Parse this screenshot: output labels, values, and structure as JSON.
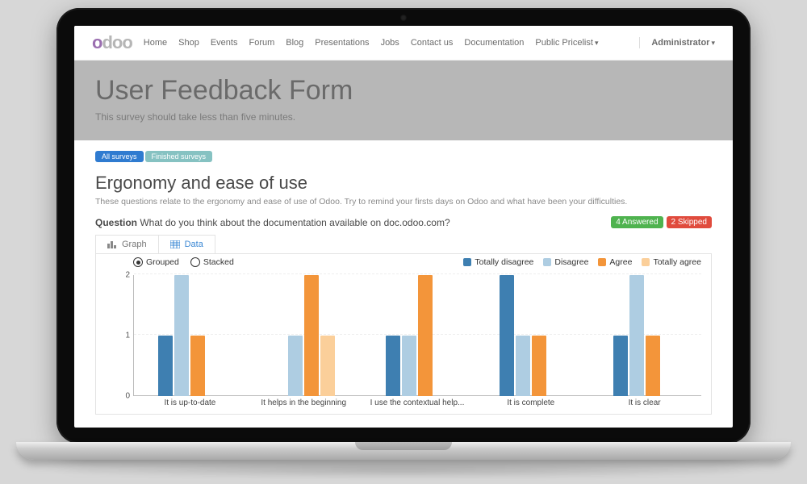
{
  "brand": {
    "text": "odoo"
  },
  "nav": {
    "items": [
      "Home",
      "Shop",
      "Events",
      "Forum",
      "Blog",
      "Presentations",
      "Jobs",
      "Contact us",
      "Documentation",
      "Public Pricelist"
    ],
    "user": "Administrator"
  },
  "hero": {
    "title": "User Feedback Form",
    "subtitle": "This survey should take less than five minutes."
  },
  "pills": {
    "all": "All surveys",
    "finished": "Finished surveys"
  },
  "section": {
    "title": "Ergonomy and ease of use",
    "desc": "These questions relate to the ergonomy and ease of use of Odoo. Try to remind your firsts days on Odoo and what have been your difficulties."
  },
  "question": {
    "label": "Question",
    "text": "What do you think about the documentation available on doc.odoo.com?",
    "answered_label": "4 Answered",
    "skipped_label": "2 Skipped"
  },
  "tabs": {
    "graph": "Graph",
    "data": "Data"
  },
  "toggles": {
    "grouped": "Grouped",
    "stacked": "Stacked"
  },
  "legend": {
    "td": "Totally disagree",
    "d": "Disagree",
    "a": "Agree",
    "ta": "Totally agree"
  },
  "chart_data": {
    "type": "bar",
    "grouping": "grouped",
    "ylabel": "",
    "xlabel": "",
    "ylim": [
      0,
      2
    ],
    "yticks": [
      0,
      1,
      2
    ],
    "categories": [
      "It is up-to-date",
      "It helps in the beginning",
      "I use the contextual help...",
      "It is complete",
      "It is clear"
    ],
    "series": [
      {
        "name": "Totally disagree",
        "color": "#3e7fb1",
        "values": [
          1,
          0,
          1,
          2,
          1
        ]
      },
      {
        "name": "Disagree",
        "color": "#aecde2",
        "values": [
          2,
          1,
          1,
          1,
          2
        ]
      },
      {
        "name": "Agree",
        "color": "#f3953a",
        "values": [
          1,
          2,
          2,
          1,
          1
        ]
      },
      {
        "name": "Totally agree",
        "color": "#fbcf9a",
        "values": [
          0,
          1,
          0,
          0,
          0
        ]
      }
    ]
  }
}
